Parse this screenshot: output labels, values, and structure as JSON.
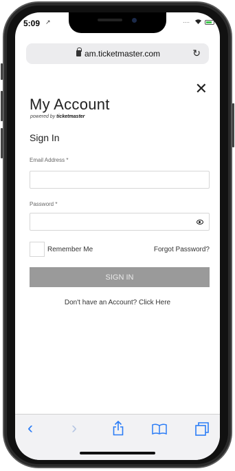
{
  "status_bar": {
    "time": "5:09",
    "location_arrow": "↗",
    "signal": "....",
    "wifi": "wifi-icon",
    "battery": "battery-icon"
  },
  "browser": {
    "url": "am.ticketmaster.com",
    "reload_icon": "reload-icon",
    "lock_icon": "lock-icon"
  },
  "page": {
    "title": "My Account",
    "powered_by_prefix": "powered by",
    "powered_by_brand": "ticketmaster",
    "close_glyph": "✕",
    "section": "Sign In",
    "email_label": "Email Address *",
    "email_value": "",
    "password_label": "Password *",
    "password_value": "",
    "remember_me": "Remember Me",
    "forgot_password": "Forgot Password?",
    "sign_in_button": "SIGN IN",
    "no_account_link": "Don't have an Account? Click Here"
  },
  "toolbar": {
    "back": "‹",
    "forward": "›",
    "share": "⇪",
    "bookmarks": "📖",
    "tabs": "❐"
  },
  "colors": {
    "button_bg": "#9a9a9a",
    "toolbar_accent": "#2a7cf6"
  }
}
